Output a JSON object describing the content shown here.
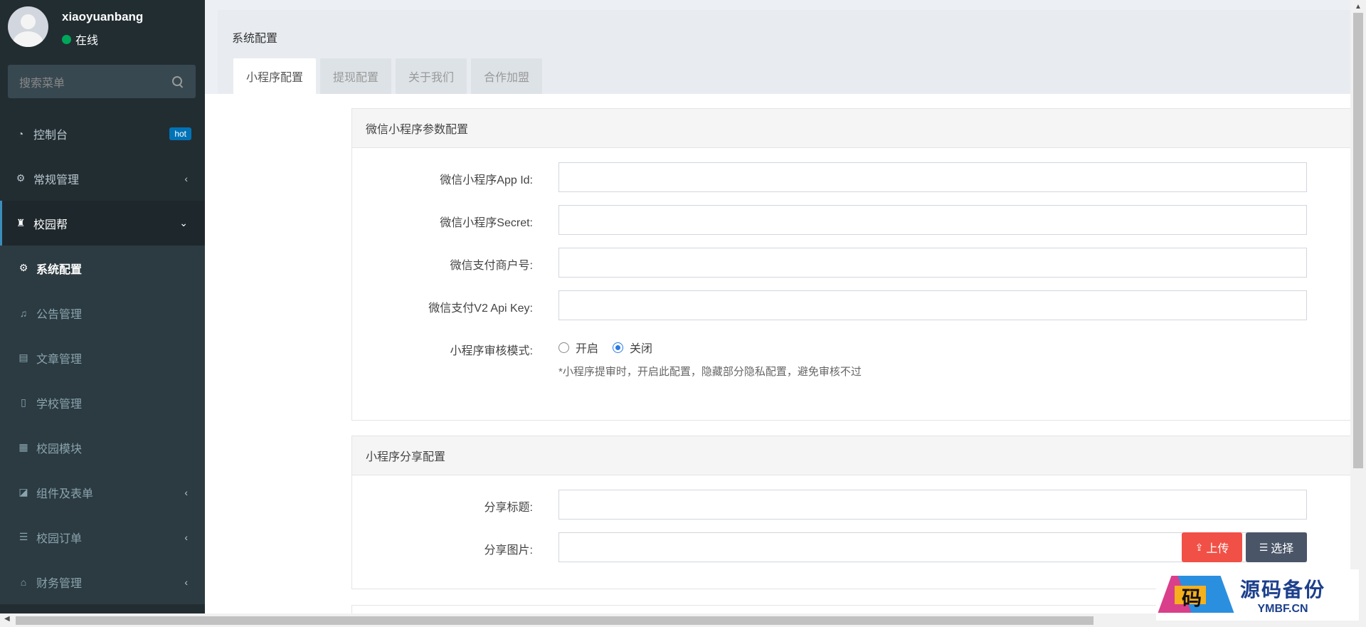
{
  "user": {
    "name": "xiaoyuanbang",
    "status": "在线"
  },
  "search": {
    "placeholder": "搜索菜单"
  },
  "menu": [
    {
      "label": "控制台",
      "icon": "dashboard-icon",
      "badge": "hot"
    },
    {
      "label": "常规管理",
      "icon": "cogs-icon"
    },
    {
      "label": "校园帮",
      "icon": "campus-icon"
    }
  ],
  "submenu": [
    {
      "label": "系统配置",
      "icon": "cogs-icon"
    },
    {
      "label": "公告管理",
      "icon": "bell-icon"
    },
    {
      "label": "文章管理",
      "icon": "article-icon"
    },
    {
      "label": "学校管理",
      "icon": "building-icon"
    },
    {
      "label": "校园模块",
      "icon": "grid-icon"
    },
    {
      "label": "组件及表单",
      "icon": "widget-icon"
    },
    {
      "label": "校园订单",
      "icon": "list-icon"
    },
    {
      "label": "财务管理",
      "icon": "bank-icon"
    }
  ],
  "page": {
    "title": "系统配置",
    "tabs": [
      "小程序配置",
      "提现配置",
      "关于我们",
      "合作加盟"
    ]
  },
  "wechat_box": {
    "title": "微信小程序参数配置",
    "fields": {
      "app_id": "微信小程序App Id:",
      "secret": "微信小程序Secret:",
      "mch_id": "微信支付商户号:",
      "api_key": "微信支付V2 Api Key:",
      "audit_mode": "小程序审核模式:"
    },
    "audit_options": {
      "on": "开启",
      "off": "关闭",
      "selected": "off"
    },
    "audit_help": "*小程序提审时，开启此配置，隐藏部分隐私配置，避免审核不过"
  },
  "share_box": {
    "title": "小程序分享配置",
    "fields": {
      "share_title": "分享标题:",
      "share_image": "分享图片:"
    },
    "upload_label": "上传",
    "choose_label": "选择"
  },
  "watermark": {
    "cn": "源码备份",
    "en": "YMBF.CN",
    "glyph": "码"
  },
  "colors": {
    "sidebar": "#222d32",
    "accent": "#3c8dbc",
    "upload": "#f15046",
    "choose": "#4a5568",
    "online": "#00a65a"
  }
}
